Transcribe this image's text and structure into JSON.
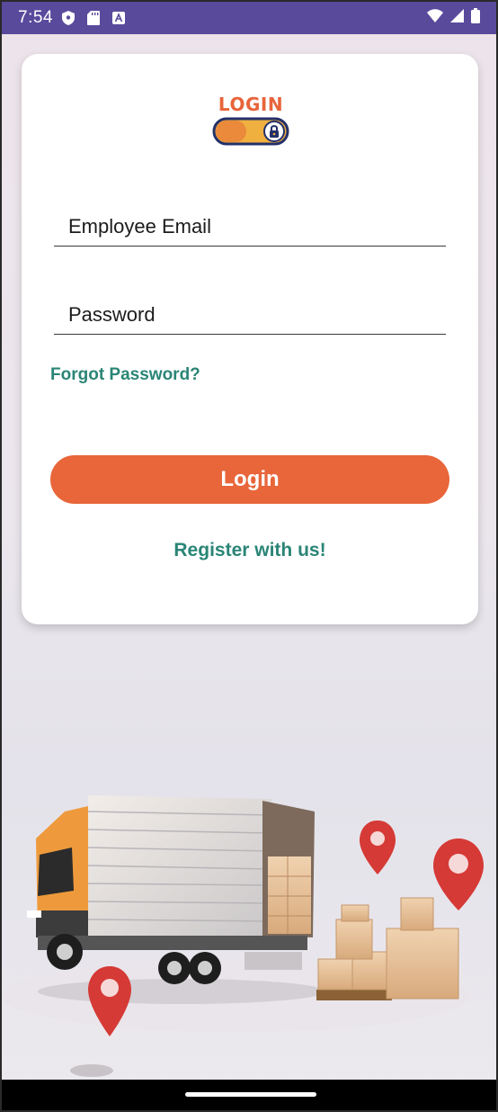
{
  "status_bar": {
    "time": "7:54",
    "left_icons": [
      "shield-icon",
      "sd-card-icon",
      "font-icon"
    ],
    "right_icons": [
      "wifi-icon",
      "signal-icon",
      "battery-icon"
    ],
    "color": "#5a4a9c"
  },
  "logo": {
    "title": "LOGIN",
    "icon": "lock-toggle-icon"
  },
  "form": {
    "email_placeholder": "Employee Email",
    "password_placeholder": "Password",
    "forgot_label": "Forgot Password?",
    "login_label": "Login",
    "register_label": "Register with us!"
  },
  "colors": {
    "accent": "#e8663a",
    "link": "#2a8576"
  }
}
